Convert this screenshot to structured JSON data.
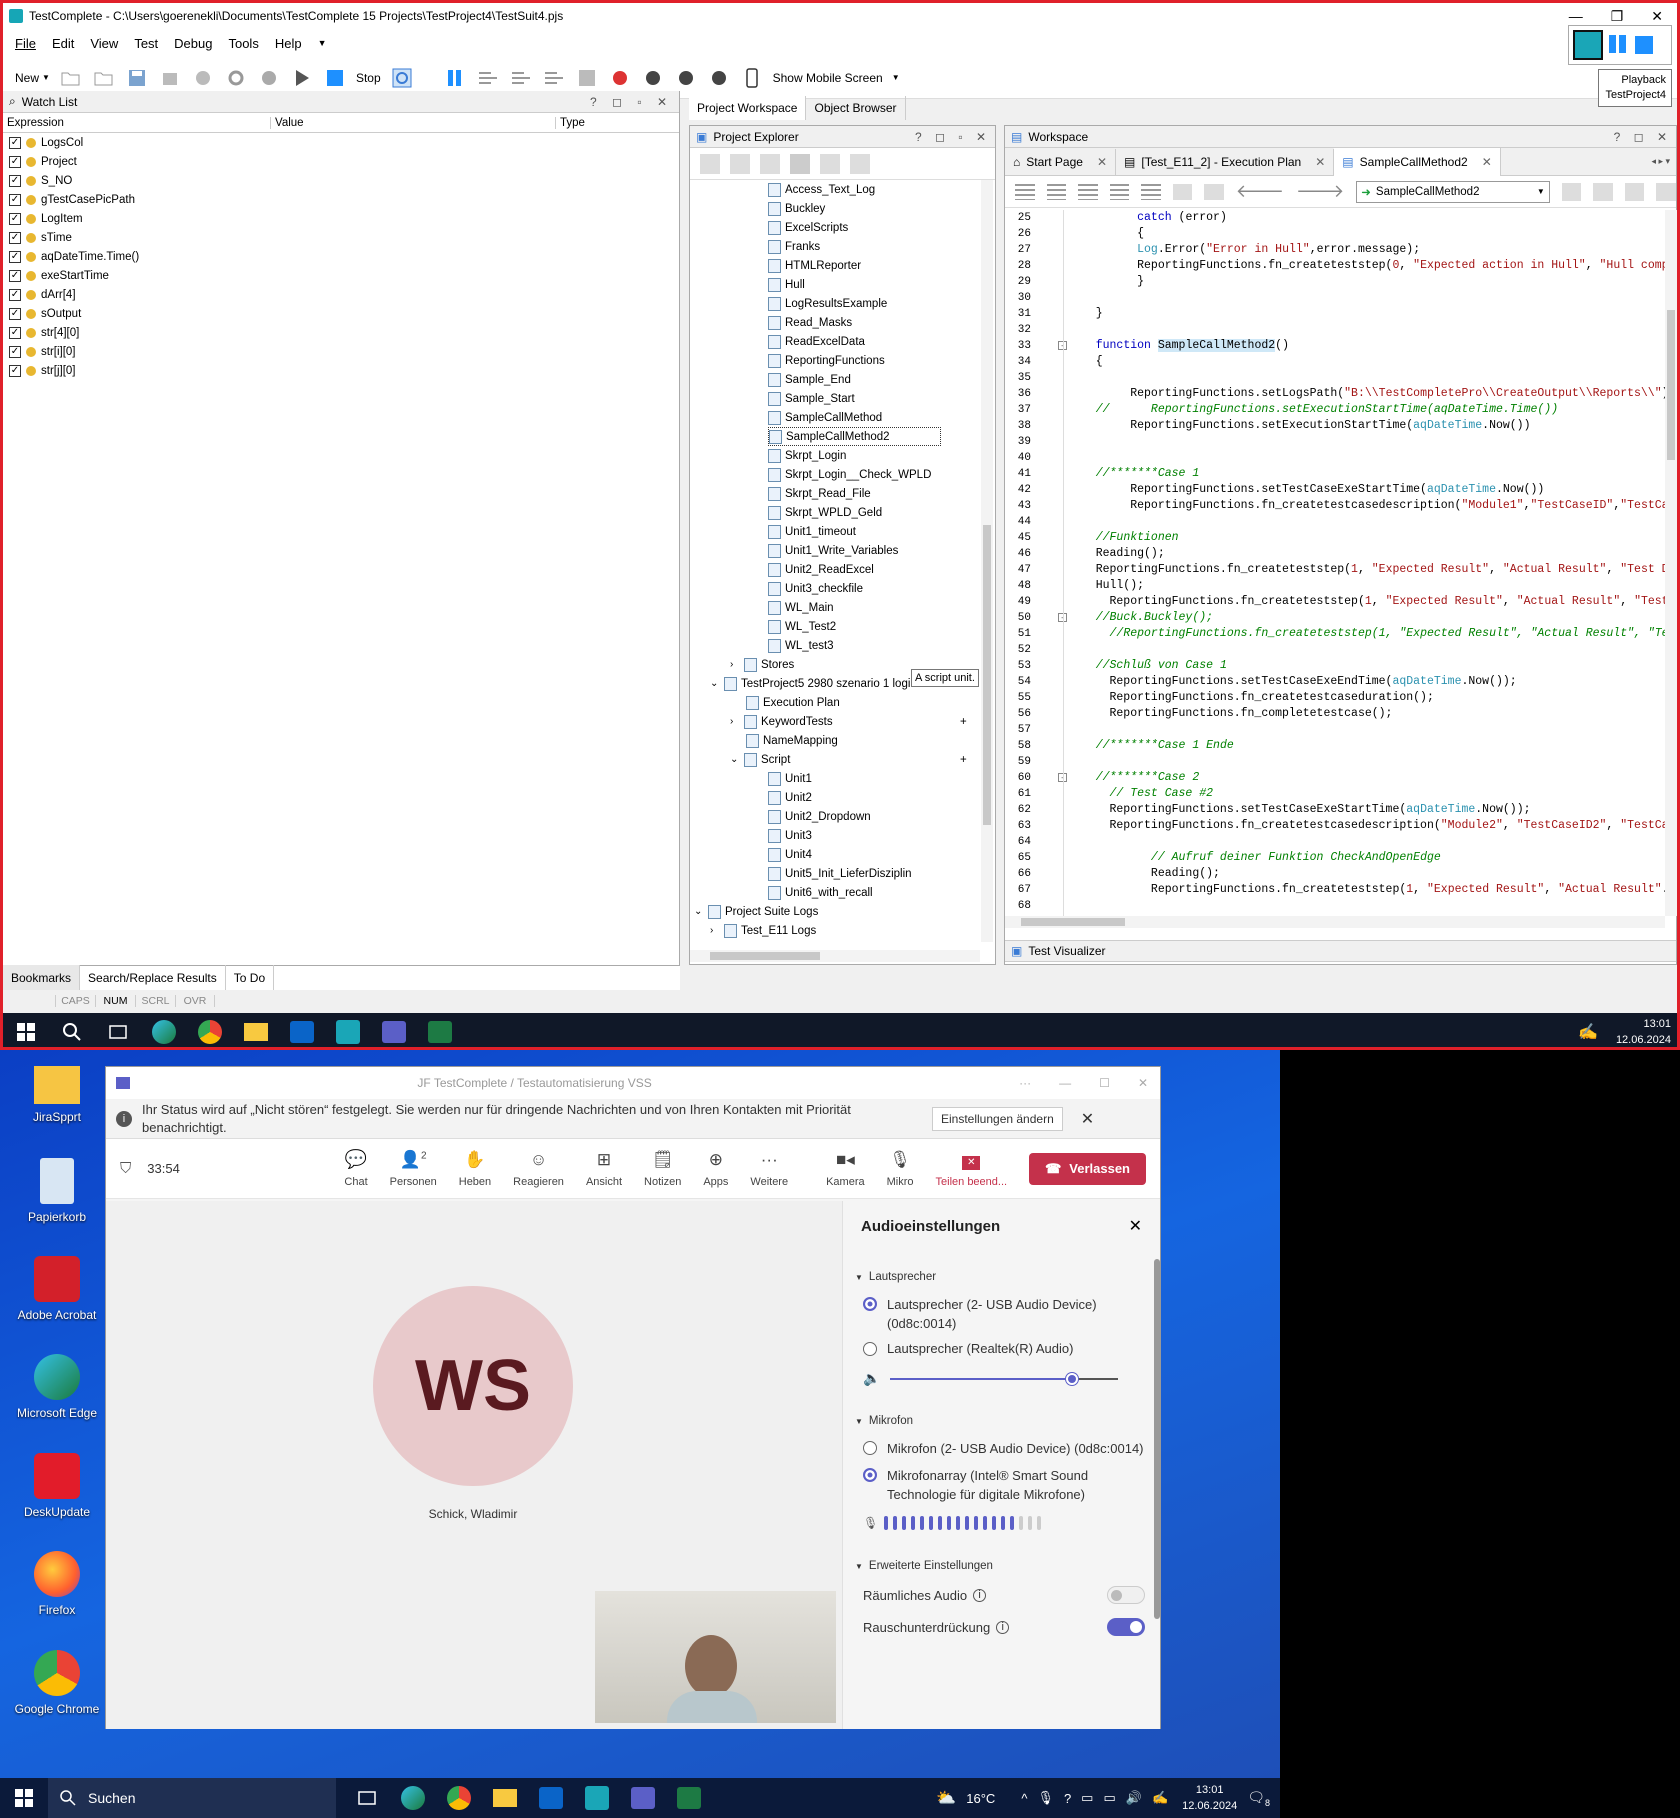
{
  "window": {
    "title": "TestComplete - C:\\Users\\goerenekli\\Documents\\TestComplete 15 Projects\\TestProject4\\TestSuit4.pjs"
  },
  "menu": [
    "File",
    "Edit",
    "View",
    "Test",
    "Debug",
    "Tools",
    "Help"
  ],
  "toolbar": {
    "new_label": "New",
    "stop_label": "Stop",
    "mobile_label": "Show Mobile Screen"
  },
  "playback": {
    "label": "Playback",
    "project": "TestProject4"
  },
  "watch": {
    "title": "Watch List",
    "col_expression": "Expression",
    "col_value": "Value",
    "col_type": "Type",
    "items": [
      "LogsCol",
      "Project",
      "S_NO",
      "gTestCasePicPath",
      "LogItem",
      "sTime",
      "aqDateTime.Time()",
      "exeStartTime",
      "dArr[4]",
      "sOutput",
      "str[4][0]",
      "str[i][0]",
      "str[j][0]"
    ]
  },
  "bottom_tabs": [
    "Bookmarks",
    "Search/Replace Results",
    "To Do"
  ],
  "status": [
    "CAPS",
    "NUM",
    "SCRL",
    "OVR"
  ],
  "workspace_tabs": [
    "Project Workspace",
    "Object Browser"
  ],
  "explorer": {
    "title": "Project Explorer",
    "units1": [
      "Access_Text_Log",
      "Buckley",
      "ExcelScripts",
      "Franks",
      "HTMLReporter",
      "Hull",
      "LogResultsExample",
      "Read_Masks",
      "ReadExcelData",
      "ReportingFunctions",
      "Sample_End",
      "Sample_Start",
      "SampleCallMethod",
      "SampleCallMethod2",
      "Skrpt_Login",
      "Skrpt_Login__Check_WPLD",
      "Skrpt_Read_File",
      "Skrpt_WPLD_Geld",
      "Unit1_timeout",
      "Unit1_Write_Variables",
      "Unit2_ReadExcel",
      "Unit3_checkfile",
      "WL_Main",
      "WL_Test2",
      "WL_test3"
    ],
    "stores": "Stores",
    "project5": "TestProject5 2980 szenario 1 login und ändern",
    "execution_plan": "Execution Plan",
    "keyword_tests": "KeywordTests",
    "name_mapping": "NameMapping",
    "script": "Script",
    "units2": [
      "Unit1",
      "Unit2",
      "Unit2_Dropdown",
      "Unit3",
      "Unit4",
      "Unit5_Init_LieferDisziplin",
      "Unit6_with_recall"
    ],
    "suite_logs": "Project Suite Logs",
    "test_logs": "Test_E11 Logs",
    "tooltip": "A script unit."
  },
  "editor": {
    "title": "Workspace",
    "tabs": [
      "Start Page",
      "[Test_E11_2] - Execution Plan",
      "SampleCallMethod2"
    ],
    "routine": "SampleCallMethod2",
    "visualizer": "Test Visualizer",
    "line_numbers": [
      "25",
      "26",
      "27",
      "28",
      "29",
      "30",
      "31",
      "32",
      "33",
      "34",
      "35",
      "36",
      "37",
      "38",
      "39",
      "40",
      "41",
      "42",
      "43",
      "44",
      "45",
      "46",
      "47",
      "48",
      "49",
      "50",
      "51",
      "52",
      "53",
      "54",
      "55",
      "56",
      "57",
      "58",
      "59",
      "60",
      "61",
      "62",
      "63",
      "64",
      "65",
      "66",
      "67",
      "68"
    ]
  },
  "taskbar_top": {
    "time": "13:01",
    "date": "12.06.2024"
  },
  "desktop_icons": [
    "JiraSpprt",
    "Papierkorb",
    "Adobe Acrobat",
    "Microsoft Edge",
    "DeskUpdate",
    "Firefox",
    "Google Chrome"
  ],
  "teams": {
    "title": "JF TestComplete / Testautomatisierung VSS",
    "banner": "Ihr Status wird auf „Nicht stören“ festgelegt. Sie werden nur für dringende Nachrichten und von Ihren Kontakten mit Priorität benachrichtigt.",
    "banner_button": "Einstellungen ändern",
    "timer": "33:54",
    "controls": [
      "Chat",
      "Personen",
      "Heben",
      "Reagieren",
      "Ansicht",
      "Notizen",
      "Apps",
      "Weitere",
      "Kamera",
      "Mikro",
      "Teilen beend..."
    ],
    "people_count": "2",
    "leave": "Verlassen",
    "avatar_initials": "WS",
    "participant": "Schick, Wladimir",
    "audio": {
      "title": "Audioeinstellungen",
      "speaker_section": "Lautsprecher",
      "speaker1": "Lautsprecher (2- USB Audio Device) (0d8c:0014)",
      "speaker2": "Lautsprecher (Realtek(R) Audio)",
      "volume": 0.8,
      "mic_section": "Mikrofon",
      "mic1": "Mikrofon (2- USB Audio Device) (0d8c:0014)",
      "mic2": "Mikrofonarray (Intel® Smart Sound Technologie für digitale Mikrofone)",
      "advanced": "Erweiterte Einstellungen",
      "spatial": "Räumliches Audio",
      "noise": "Rauschunterdrückung"
    }
  },
  "taskbar_bottom": {
    "search": "Suchen",
    "weather": "16°C",
    "time": "13:01",
    "date": "12.06.2024",
    "notifications": "8"
  }
}
